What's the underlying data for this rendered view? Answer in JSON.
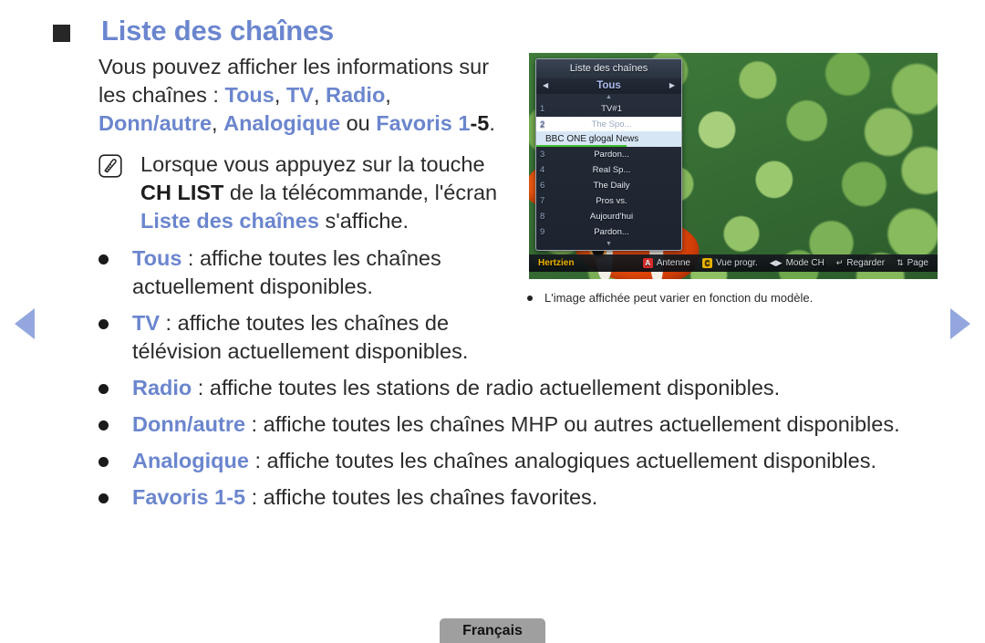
{
  "nav": {
    "prev_label": "previous page",
    "next_label": "next page"
  },
  "heading": {
    "title": "Liste des chaînes"
  },
  "intro": {
    "line1": "Vous pouvez afficher les informations sur",
    "line2_prefix": "les chaînes : ",
    "opt_tous": "Tous",
    "opt_tv": "TV",
    "opt_radio": "Radio",
    "opt_donn": "Donn/",
    "opt_autre": "autre",
    "opt_analogique": "Analogique",
    "conj_ou": " ou ",
    "opt_favoris": "Favoris 1",
    "opt_favoris_range": "-5",
    "period": "."
  },
  "note": {
    "icon": "note-pencil-icon",
    "text_part1": "Lorsque vous appuyez sur la touche ",
    "key": "CH LIST",
    "text_part2": " de la télécommande, l'écran ",
    "screen_name": "Liste des chaînes",
    "text_part3": " s'affiche."
  },
  "bullets": [
    {
      "term": "Tous",
      "rest": " : affiche toutes les chaînes actuellement disponibles."
    },
    {
      "term": "TV",
      "rest": " : affiche toutes les chaînes de télévision actuellement disponibles."
    },
    {
      "term": "Radio",
      "rest": " : affiche toutes les stations de radio actuellement disponibles."
    },
    {
      "term": "Donn/autre",
      "rest": " : affiche toutes les chaînes MHP ou autres actuellement disponibles."
    },
    {
      "term": "Analogique",
      "rest": " : affiche toutes les chaînes analogiques actuellement disponibles."
    },
    {
      "term": "Favoris 1-5",
      "rest": " : affiche toutes les chaînes favorites."
    }
  ],
  "tv_screenshot": {
    "panel_title": "Liste des chaînes",
    "tab_selected": "Tous",
    "tab_prev_icon": "chevron-left-icon",
    "tab_next_icon": "chevron-right-icon",
    "scroll_up_icon": "caret-up-icon",
    "scroll_down_icon": "caret-down-icon",
    "channels": [
      {
        "num": "1",
        "name": "TV#1",
        "state": "normal"
      },
      {
        "num": "2",
        "name": "The Spo...",
        "state": "selected"
      },
      {
        "num": "3",
        "name": "Pardon...",
        "state": "normal"
      },
      {
        "num": "4",
        "name": "Real Sp...",
        "state": "normal"
      },
      {
        "num": "6",
        "name": "The Daily",
        "state": "normal"
      },
      {
        "num": "7",
        "name": "Pros vs.",
        "state": "normal"
      },
      {
        "num": "8",
        "name": "Aujourd'hui",
        "state": "normal"
      },
      {
        "num": "9",
        "name": "Pardon...",
        "state": "normal"
      }
    ],
    "info_row": {
      "text": "BBC ONE glogal News",
      "progress_color": "#3fbf2f"
    },
    "osd_bar": {
      "source_label": "Hertzien",
      "items": [
        {
          "chip": "A",
          "chip_color": "red",
          "label": "Antenne",
          "icon": "key-a-icon"
        },
        {
          "chip": "C",
          "chip_color": "yellow",
          "label": "Vue progr.",
          "icon": "key-c-icon"
        },
        {
          "chip": "◀▶",
          "chip_color": "none",
          "label": "Mode CH",
          "icon": "left-right-arrows-icon"
        },
        {
          "chip": "↵",
          "chip_color": "none",
          "label": "Regarder",
          "icon": "enter-key-icon"
        },
        {
          "chip": "⇅",
          "chip_color": "none",
          "label": "Page",
          "icon": "up-down-arrows-icon"
        }
      ]
    }
  },
  "caption": {
    "text": "L'image affichée peut varier en fonction du modèle."
  },
  "footer": {
    "language": "Français"
  },
  "colors": {
    "accent_blue": "#6b86ce",
    "arrow_blue": "#93a7de",
    "footer_grey": "#9f9f9f",
    "osd_yellow": "#f0b400",
    "osd_red": "#d92b2b"
  }
}
